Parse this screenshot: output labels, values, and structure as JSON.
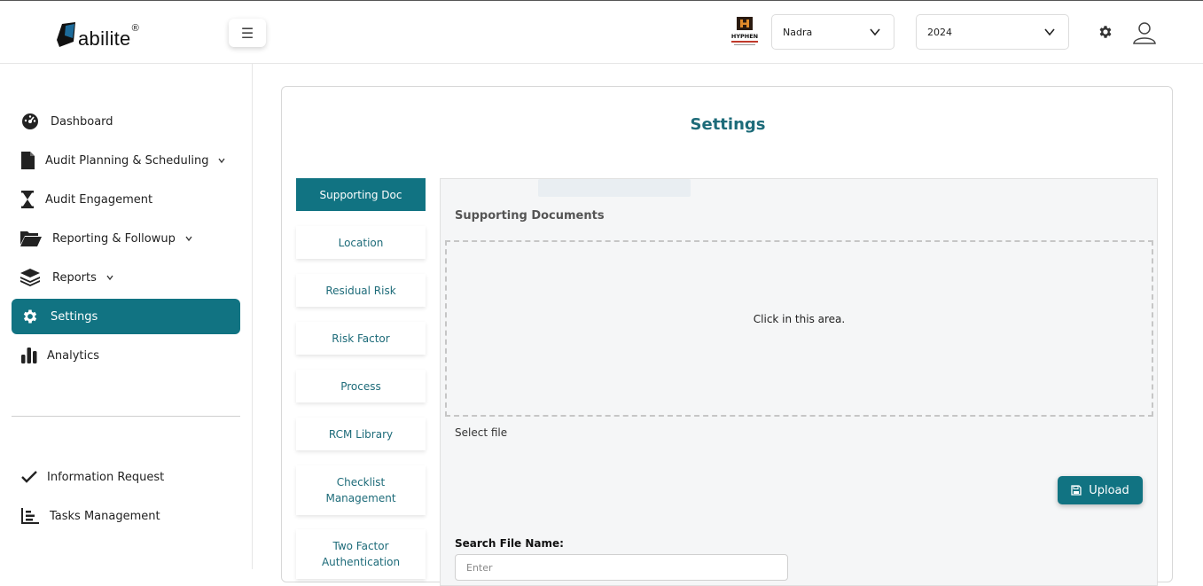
{
  "header": {
    "logo_text": "abilite",
    "logo_reg": "®",
    "hamburger_icon": "☰",
    "brand_logo_text": "HYPHEN",
    "company_select": {
      "value": "Nadra"
    },
    "year_select": {
      "value": "2024"
    },
    "settings_icon": "gear-icon",
    "user_icon": "user-icon"
  },
  "sidebar": {
    "items": [
      {
        "label": "Dashboard",
        "icon": "dashboard-icon"
      },
      {
        "label": "Audit Planning & Scheduling",
        "icon": "file-icon",
        "has_caret": true
      },
      {
        "label": "Audit Engagement",
        "icon": "hourglass-icon"
      },
      {
        "label": "Reporting & Followup",
        "icon": "folder-open-icon",
        "has_caret": true
      },
      {
        "label": "Reports",
        "icon": "layers-icon",
        "has_caret": true
      },
      {
        "label": "Settings",
        "icon": "gear-icon",
        "active": true
      },
      {
        "label": "Analytics",
        "icon": "bar-chart-icon"
      }
    ],
    "bottom_items": [
      {
        "label": "Information Request",
        "icon": "check-icon"
      },
      {
        "label": "Tasks Management",
        "icon": "tasks-chart-icon"
      }
    ],
    "accent_color": "#117382"
  },
  "main": {
    "title": "Settings",
    "tabs": [
      {
        "label": "Supporting Doc",
        "active": true
      },
      {
        "label": "Location"
      },
      {
        "label": "Residual Risk"
      },
      {
        "label": "Risk Factor"
      },
      {
        "label": "Process"
      },
      {
        "label": "RCM Library"
      },
      {
        "label": "Checklist Management"
      },
      {
        "label": "Two Factor Authentication"
      }
    ],
    "panel": {
      "title": "Supporting Documents",
      "dropzone_text": "Click in this area.",
      "select_file_label": "Select file",
      "upload_label": "Upload",
      "search_label": "Search File Name:",
      "search_placeholder": "Enter"
    }
  }
}
